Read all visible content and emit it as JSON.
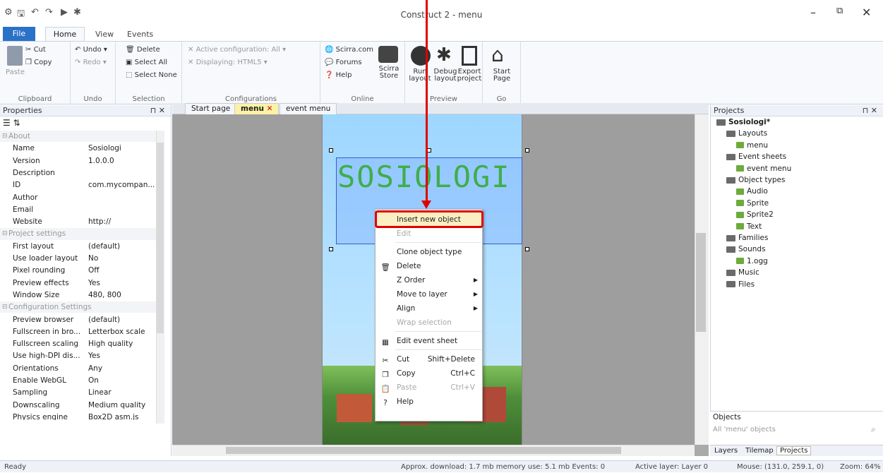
{
  "window": {
    "title": "Construct 2 - menu",
    "controls": [
      "–",
      "⧉",
      "✕"
    ]
  },
  "ribbon_tabs": [
    "File",
    "Home",
    "View",
    "Events"
  ],
  "ribbon": {
    "clipboard": {
      "label": "Clipboard",
      "paste": "Paste",
      "cut": "Cut",
      "copy": "Copy"
    },
    "undo": {
      "label": "Undo",
      "undo": "Undo",
      "redo": "Redo"
    },
    "selection": {
      "label": "Selection",
      "delete": "Delete",
      "select_all": "Select All",
      "select_none": "Select None"
    },
    "configurations": {
      "label": "Configurations",
      "active": "Active configuration: All",
      "displaying": "Displaying: HTML5"
    },
    "online": {
      "label": "Online",
      "scirra": "Scirra.com",
      "forums": "Forums",
      "help": "Help",
      "store": "Scirra Store"
    },
    "preview": {
      "label": "Preview",
      "run": "Run layout",
      "debug": "Debug layout",
      "export": "Export project"
    },
    "go": {
      "label": "Go",
      "start": "Start Page"
    }
  },
  "properties": {
    "title": "Properties",
    "rows": [
      {
        "type": "sec",
        "k": "About"
      },
      {
        "k": "Name",
        "v": "Sosiologi"
      },
      {
        "k": "Version",
        "v": "1.0.0.0"
      },
      {
        "k": "Description",
        "v": ""
      },
      {
        "k": "ID",
        "v": "com.mycompan..."
      },
      {
        "k": "Author",
        "v": ""
      },
      {
        "k": "Email",
        "v": ""
      },
      {
        "k": "Website",
        "v": "http://"
      },
      {
        "type": "sec",
        "k": "Project settings"
      },
      {
        "k": "First layout",
        "v": "(default)"
      },
      {
        "k": "Use loader layout",
        "v": "No"
      },
      {
        "k": "Pixel rounding",
        "v": "Off"
      },
      {
        "k": "Preview effects",
        "v": "Yes"
      },
      {
        "k": "Window Size",
        "v": "480, 800"
      },
      {
        "type": "sec",
        "k": "Configuration Settings"
      },
      {
        "k": "Preview browser",
        "v": "(default)"
      },
      {
        "k": "Fullscreen in bro...",
        "v": "Letterbox scale"
      },
      {
        "k": "Fullscreen scaling",
        "v": "High quality"
      },
      {
        "k": "Use high-DPI dis...",
        "v": "Yes"
      },
      {
        "k": "Orientations",
        "v": "Any"
      },
      {
        "k": "Enable WebGL",
        "v": "On"
      },
      {
        "k": "Sampling",
        "v": "Linear"
      },
      {
        "k": "Downscaling",
        "v": "Medium quality"
      },
      {
        "k": "Physics engine",
        "v": "Box2D asm.js"
      }
    ]
  },
  "doc_tabs": [
    "Start page",
    "menu",
    "event menu"
  ],
  "canvas_text": "SOSIOLOGI",
  "context_menu": [
    {
      "label": "Insert new object",
      "icon": "",
      "shortcut": ""
    },
    {
      "label": "Edit",
      "icon": "",
      "shortcut": "",
      "disabled": true
    },
    {
      "label": "Clone object type",
      "icon": "",
      "shortcut": ""
    },
    {
      "label": "Delete",
      "icon": "🗑",
      "shortcut": ""
    },
    {
      "label": "Z Order",
      "icon": "",
      "shortcut": "",
      "sub": true
    },
    {
      "label": "Move to layer",
      "icon": "",
      "shortcut": "",
      "sub": true
    },
    {
      "label": "Align",
      "icon": "",
      "shortcut": "",
      "sub": true
    },
    {
      "label": "Wrap selection",
      "icon": "",
      "shortcut": "",
      "disabled": true
    },
    {
      "label": "Edit event sheet",
      "icon": "▦",
      "shortcut": ""
    },
    {
      "label": "Cut",
      "icon": "✂",
      "shortcut": "Shift+Delete"
    },
    {
      "label": "Copy",
      "icon": "❐",
      "shortcut": "Ctrl+C"
    },
    {
      "label": "Paste",
      "icon": "📋",
      "shortcut": "Ctrl+V",
      "disabled": true
    },
    {
      "label": "Help",
      "icon": "?",
      "shortcut": ""
    }
  ],
  "projects": {
    "title": "Projects",
    "tree": [
      {
        "label": "Sosiologi*",
        "depth": 0,
        "bold": true
      },
      {
        "label": "Layouts",
        "depth": 1
      },
      {
        "label": "menu",
        "depth": 2
      },
      {
        "label": "Event sheets",
        "depth": 1
      },
      {
        "label": "event menu",
        "depth": 2
      },
      {
        "label": "Object types",
        "depth": 1
      },
      {
        "label": "Audio",
        "depth": 2
      },
      {
        "label": "Sprite",
        "depth": 2
      },
      {
        "label": "Sprite2",
        "depth": 2
      },
      {
        "label": "Text",
        "depth": 2
      },
      {
        "label": "Families",
        "depth": 1
      },
      {
        "label": "Sounds",
        "depth": 1
      },
      {
        "label": "1.ogg",
        "depth": 2
      },
      {
        "label": "Music",
        "depth": 1
      },
      {
        "label": "Files",
        "depth": 1
      }
    ]
  },
  "objects": {
    "title": "Objects",
    "placeholder": "All 'menu' objects"
  },
  "bottom_tabs": [
    "Layers",
    "Tilemap",
    "Projects"
  ],
  "status": {
    "ready": "Ready",
    "download": "Approx. download: 1.7 mb  memory use: 5.1 mb  Events: 0",
    "layer": "Active layer: Layer 0",
    "mouse": "Mouse: (131.0, 259.1, 0)",
    "zoom": "Zoom: 64%"
  }
}
